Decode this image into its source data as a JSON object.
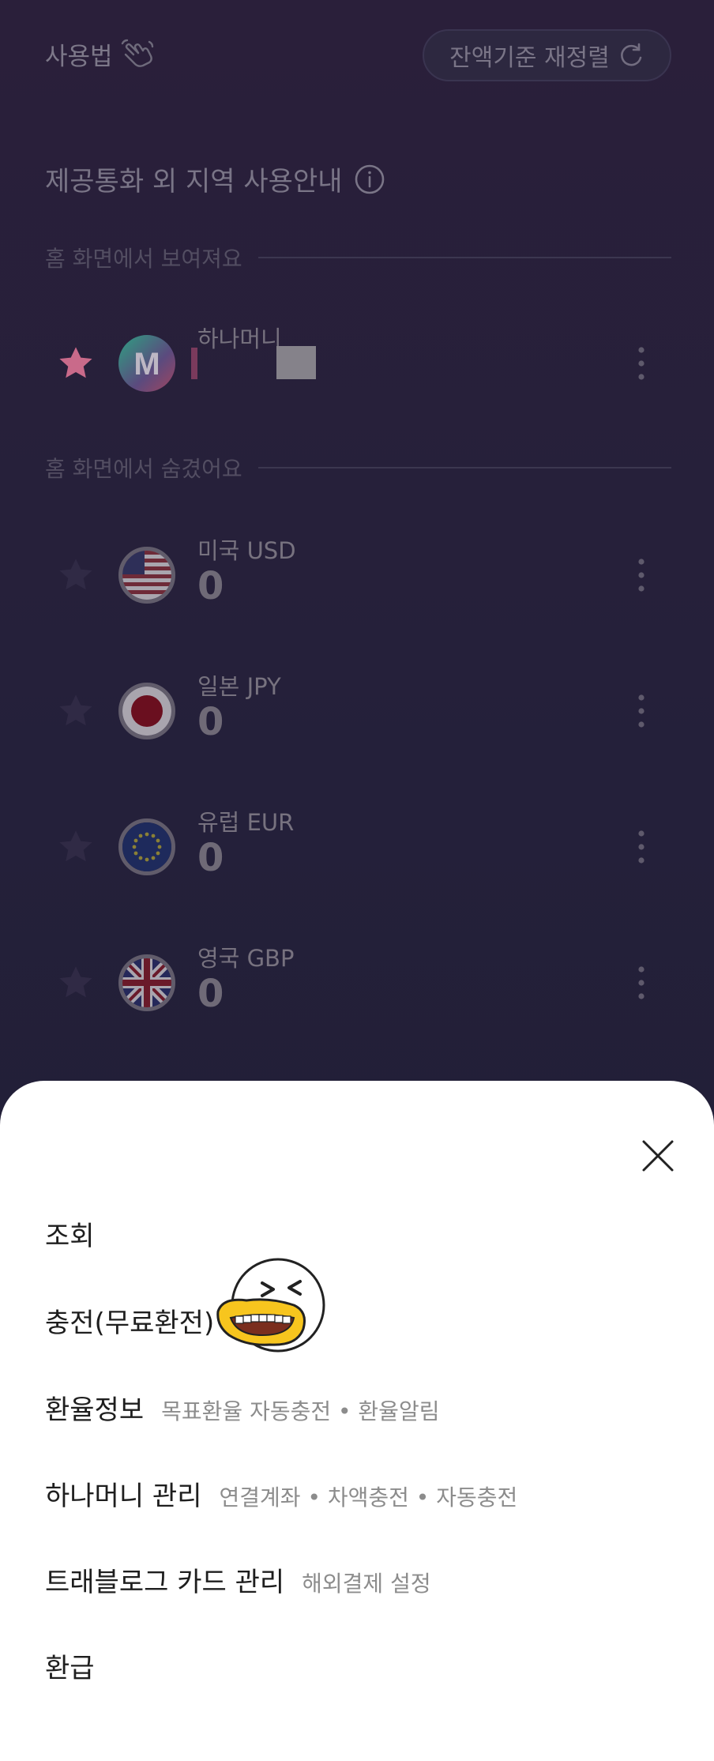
{
  "header": {
    "howto_label": "사용법",
    "reorder_label": "잔액기준 재정렬"
  },
  "notice": {
    "title": "제공통화 외 지역 사용안내"
  },
  "sections": {
    "shown_label": "홈 화면에서 보여져요",
    "hidden_label": "홈 화면에서 숨겼어요"
  },
  "shown_items": [
    {
      "name": "하나머니",
      "icon": "hanamoney-icon",
      "starred": true
    }
  ],
  "hidden_items": [
    {
      "name": "미국 USD",
      "amount": "0",
      "icon": "us-flag-icon"
    },
    {
      "name": "일본 JPY",
      "amount": "0",
      "icon": "japan-flag-icon"
    },
    {
      "name": "유럽 EUR",
      "amount": "0",
      "icon": "eu-flag-icon"
    },
    {
      "name": "영국 GBP",
      "amount": "0",
      "icon": "uk-flag-icon"
    }
  ],
  "sheet": {
    "items": [
      {
        "label": "조회",
        "sub": ""
      },
      {
        "label": "충전(무료환전)",
        "sub": ""
      },
      {
        "label": "환율정보",
        "sub": "목표환율 자동충전 • 환율알림"
      },
      {
        "label": "하나머니 관리",
        "sub": "연결계좌 • 차액충전 • 자동충전"
      },
      {
        "label": "트래블로그 카드 관리",
        "sub": "해외결제 설정"
      },
      {
        "label": "환급",
        "sub": ""
      }
    ]
  },
  "colors": {
    "background": "#24203a",
    "sheet": "#ffffff",
    "star_active": "#c96a8a"
  }
}
